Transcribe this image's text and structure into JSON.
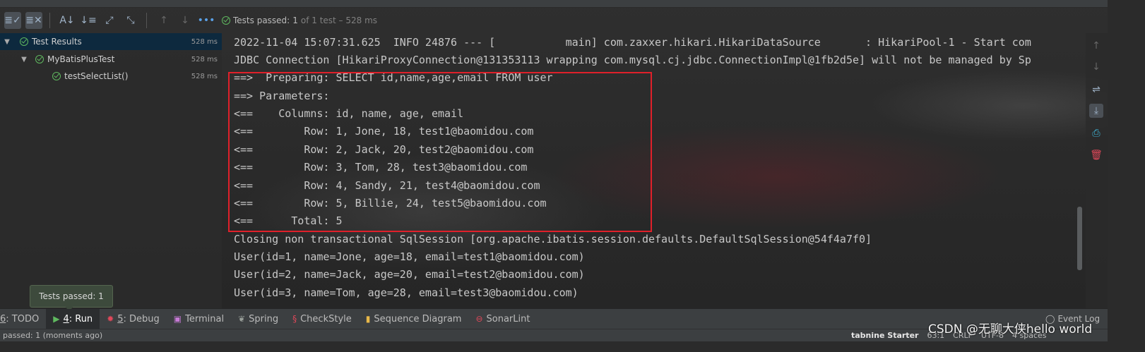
{
  "toolbar": {
    "status_prefix": "Tests passed:",
    "passed_count": "1",
    "status_detail": "of 1 test – 528 ms"
  },
  "tree": {
    "items": [
      {
        "label": "Test Results",
        "time": "528 ms"
      },
      {
        "label": "MyBatisPlusTest",
        "time": "528 ms"
      },
      {
        "label": "testSelectList()",
        "time": "528 ms"
      }
    ]
  },
  "console": {
    "lines": [
      "2022-11-04 15:07:31.625  INFO 24876 --- [           main] com.zaxxer.hikari.HikariDataSource       : HikariPool-1 - Start com",
      "JDBC Connection [HikariProxyConnection@131353113 wrapping com.mysql.cj.jdbc.ConnectionImpl@1fb2d5e] will not be managed by Sp",
      "==>  Preparing: SELECT id,name,age,email FROM user",
      "==> Parameters: ",
      "<==    Columns: id, name, age, email",
      "<==        Row: 1, Jone, 18, test1@baomidou.com",
      "<==        Row: 2, Jack, 20, test2@baomidou.com",
      "<==        Row: 3, Tom, 28, test3@baomidou.com",
      "<==        Row: 4, Sandy, 21, test4@baomidou.com",
      "<==        Row: 5, Billie, 24, test5@baomidou.com",
      "<==      Total: 5",
      "Closing non transactional SqlSession [org.apache.ibatis.session.defaults.DefaultSqlSession@54f4a7f0]",
      "User(id=1, name=Jone, age=18, email=test1@baomidou.com)",
      "User(id=2, name=Jack, age=20, email=test2@baomidou.com)",
      "User(id=3, name=Tom, age=28, email=test3@baomidou.com)"
    ]
  },
  "tooltip": {
    "text": "Tests passed: 1"
  },
  "bottombar": {
    "tabs": [
      {
        "num": "6",
        "label": ": TODO"
      },
      {
        "num": "4",
        "label": ": Run"
      },
      {
        "num": "5",
        "label": ": Debug"
      },
      {
        "num": "",
        "label": "Terminal"
      },
      {
        "num": "",
        "label": "Spring"
      },
      {
        "num": "",
        "label": "CheckStyle"
      },
      {
        "num": "",
        "label": "Sequence Diagram"
      },
      {
        "num": "",
        "label": "SonarLint"
      }
    ],
    "event_log": "Event Log"
  },
  "statusbar": {
    "left": "passed: 1 (moments ago)",
    "brand": "tabnine Starter",
    "position": "63:1",
    "line_sep": "CRLF",
    "encoding": "UTF-8",
    "indent": "4 spaces"
  },
  "watermark": "CSDN @无聊大侠hello world",
  "colors": {
    "highlight": "#e0202a",
    "passed": "#5fb85f",
    "selection": "#0d293e"
  }
}
